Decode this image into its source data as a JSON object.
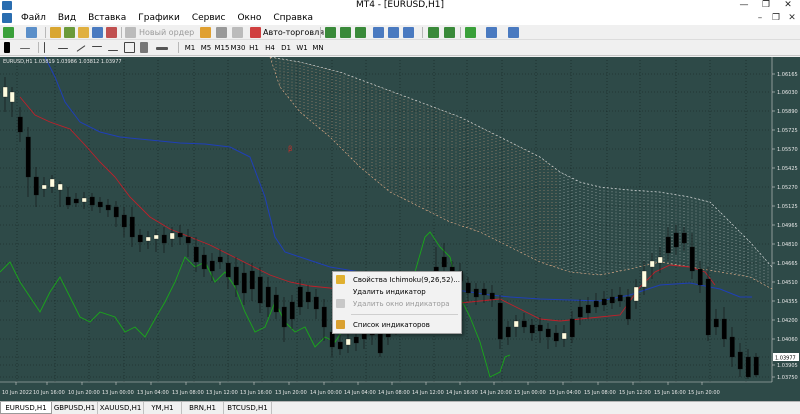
{
  "window": {
    "title": "MT4 - [EURUSD,H1]",
    "minimize": "—",
    "maximize": "❐",
    "close": "✕"
  },
  "menu": {
    "items": [
      "Файл",
      "Вид",
      "Вставка",
      "Графики",
      "Сервис",
      "Окно",
      "Справка"
    ],
    "right": [
      "–",
      "❐",
      "✕"
    ]
  },
  "toolbar": {
    "new_order": "Новый ордер",
    "auto_trading": "Авто-торговля"
  },
  "timeframes": [
    "M1",
    "M5",
    "M15",
    "M30",
    "H1",
    "H4",
    "D1",
    "W1",
    "MN"
  ],
  "chart_header": "EURUSD,H1  1.03819 1.03986 1.03812 1.03977",
  "price_axis": [
    "1.06165",
    "1.06030",
    "1.05890",
    "1.05725",
    "1.05570",
    "1.05425",
    "1.05270",
    "1.05125",
    "1.04965",
    "1.04810",
    "1.04665",
    "1.04510",
    "1.04355",
    "1.04200",
    "1.04060",
    "1.03977",
    "1.03905",
    "1.03750"
  ],
  "current_price": "1.03977",
  "time_axis": [
    "10 Jun 2022",
    "10 Jun 16:00",
    "10 Jun 20:00",
    "13 Jun 00:00",
    "13 Jun 04:00",
    "13 Jun 08:00",
    "13 Jun 12:00",
    "13 Jun 16:00",
    "13 Jun 20:00",
    "14 Jun 00:00",
    "14 Jun 04:00",
    "14 Jun 08:00",
    "14 Jun 12:00",
    "14 Jun 16:00",
    "14 Jun 20:00",
    "15 Jun 00:00",
    "15 Jun 04:00",
    "15 Jun 08:00",
    "15 Jun 12:00",
    "15 Jun 16:00",
    "15 Jun 20:00"
  ],
  "context_menu": {
    "items": [
      {
        "label": "Свойства Ichimoku(9,26,52)...",
        "disabled": false
      },
      {
        "label": "Удалить индикатор",
        "disabled": false
      },
      {
        "label": "Удалить окно индикатора",
        "disabled": true
      },
      {
        "label": "Список индикаторов",
        "disabled": false
      }
    ]
  },
  "tabs": [
    "EURUSD,H1",
    "GBPUSD,H1",
    "XAUUSD,H1",
    "YM,H1",
    "BRN,H1",
    "BTCUSD,H1"
  ],
  "active_tab": "EURUSD,H1",
  "colors": {
    "chart_bg": "#2e4a48",
    "bull_candle": "#fffde0",
    "bear_candle": "#000000",
    "tenkan": "#c0202a",
    "kijun": "#1f3fb8",
    "chikou": "#1aa81a",
    "kumo_a": "#f0b48c",
    "kumo_b": "#e8e8e8"
  }
}
